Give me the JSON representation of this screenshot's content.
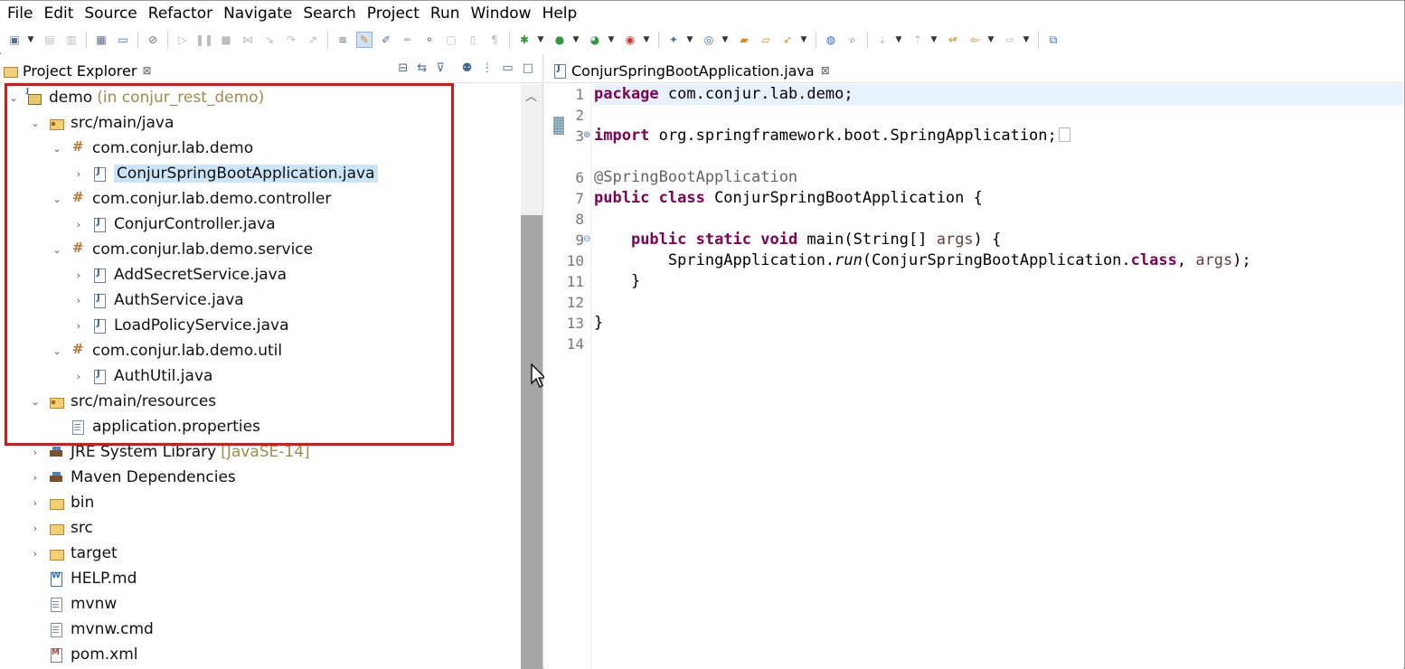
{
  "menu": [
    "File",
    "Edit",
    "Source",
    "Refactor",
    "Navigate",
    "Search",
    "Project",
    "Run",
    "Window",
    "Help"
  ],
  "explorer": {
    "tab_label": "Project Explorer",
    "close_glyph": "⊠",
    "tree": [
      {
        "label": "demo",
        "hint": "(in conjur_rest_demo)",
        "icon": "project-icon",
        "chev": "⌄",
        "depth": 0
      },
      {
        "label": "src/main/java",
        "icon": "source-folder-icon",
        "chev": "⌄",
        "depth": 1
      },
      {
        "label": "com.conjur.lab.demo",
        "icon": "package-icon",
        "chev": "⌄",
        "depth": 2
      },
      {
        "label": "ConjurSpringBootApplication.java",
        "icon": "java-file-icon",
        "chev": "›",
        "depth": 3,
        "selected": true
      },
      {
        "label": "com.conjur.lab.demo.controller",
        "icon": "package-icon",
        "chev": "⌄",
        "depth": 2
      },
      {
        "label": "ConjurController.java",
        "icon": "java-file-icon",
        "chev": "›",
        "depth": 3
      },
      {
        "label": "com.conjur.lab.demo.service",
        "icon": "package-icon",
        "chev": "⌄",
        "depth": 2
      },
      {
        "label": "AddSecretService.java",
        "icon": "java-file-icon",
        "chev": "›",
        "depth": 3
      },
      {
        "label": "AuthService.java",
        "icon": "java-file-icon",
        "chev": "›",
        "depth": 3
      },
      {
        "label": "LoadPolicyService.java",
        "icon": "java-file-icon",
        "chev": "›",
        "depth": 3
      },
      {
        "label": "com.conjur.lab.demo.util",
        "icon": "package-icon",
        "chev": "⌄",
        "depth": 2
      },
      {
        "label": "AuthUtil.java",
        "icon": "java-file-icon",
        "chev": "›",
        "depth": 3
      },
      {
        "label": "src/main/resources",
        "icon": "source-folder-icon",
        "chev": "⌄",
        "depth": 1
      },
      {
        "label": "application.properties",
        "icon": "properties-file-icon",
        "chev": "",
        "depth": 2
      },
      {
        "label": "JRE System Library",
        "hint": "[JavaSE-14]",
        "icon": "library-icon",
        "chev": "›",
        "depth": 1
      },
      {
        "label": "Maven Dependencies",
        "icon": "library-icon",
        "chev": "›",
        "depth": 1
      },
      {
        "label": "bin",
        "icon": "folder-icon",
        "chev": "›",
        "depth": 1
      },
      {
        "label": "src",
        "icon": "folder-icon",
        "chev": "›",
        "depth": 1
      },
      {
        "label": "target",
        "icon": "folder-icon",
        "chev": "›",
        "depth": 1
      },
      {
        "label": "HELP.md",
        "icon": "markdown-file-icon",
        "chev": "",
        "depth": 1
      },
      {
        "label": "mvnw",
        "icon": "text-file-icon",
        "chev": "",
        "depth": 1
      },
      {
        "label": "mvnw.cmd",
        "icon": "text-file-icon",
        "chev": "",
        "depth": 1
      },
      {
        "label": "pom.xml",
        "icon": "pom-xml-icon",
        "chev": "",
        "depth": 1
      }
    ]
  },
  "editor": {
    "tab_label": "ConjurSpringBootApplication.java",
    "close_glyph": "⊠",
    "line_numbers": [
      "1",
      "2",
      "3",
      "6",
      "7",
      "8",
      "9",
      "10",
      "11",
      "12",
      "13",
      "14"
    ],
    "code": {
      "l1_kw": "package",
      "l1_rest": " com.conjur.lab.demo;",
      "l3_kw": "import",
      "l3_rest": " org.springframework.boot.SpringApplication;",
      "l6_ann": "@SpringBootApplication",
      "l7_kw": "public class",
      "l7_rest": " ConjurSpringBootApplication {",
      "l9_indent": "    ",
      "l9_kw": "public static void",
      "l9_mid": " main(String[] ",
      "l9_param": "args",
      "l9_end": ") {",
      "l10_indent": "        ",
      "l10_a": "SpringApplication.",
      "l10_run": "run",
      "l10_b": "(ConjurSpringBootApplication.",
      "l10_class": "class",
      "l10_c": ", ",
      "l10_param": "args",
      "l10_d": ");",
      "l11": "    }",
      "l13": "}"
    }
  }
}
